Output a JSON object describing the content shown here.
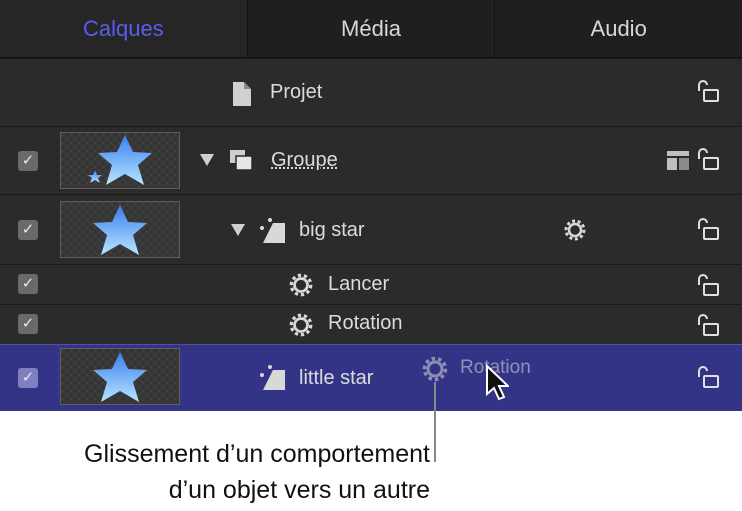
{
  "tabs": {
    "layers": "Calques",
    "media": "Média",
    "audio": "Audio"
  },
  "colors": {
    "active_tab": "#5b5bf0",
    "selected_row": "#343487",
    "panel_bg": "#2a2a2a"
  },
  "rows": {
    "project": {
      "label": "Projet",
      "icon": "document-icon"
    },
    "group": {
      "label": "Groupe",
      "icon": "group-icon",
      "checked": true
    },
    "big_star": {
      "label": "big star",
      "icon": "shape-icon",
      "checked": true
    },
    "lancer": {
      "label": "Lancer",
      "icon": "behavior-gear-icon",
      "checked": true
    },
    "rotation": {
      "label": "Rotation",
      "icon": "behavior-gear-icon",
      "checked": true
    },
    "little_star": {
      "label": "little star",
      "icon": "shape-icon",
      "checked": true
    }
  },
  "drag_ghost": {
    "label": "Rotation"
  },
  "check_glyph": "✓",
  "caption": {
    "line1": "Glissement d’un comportement",
    "line2": "d’un objet vers un autre"
  }
}
